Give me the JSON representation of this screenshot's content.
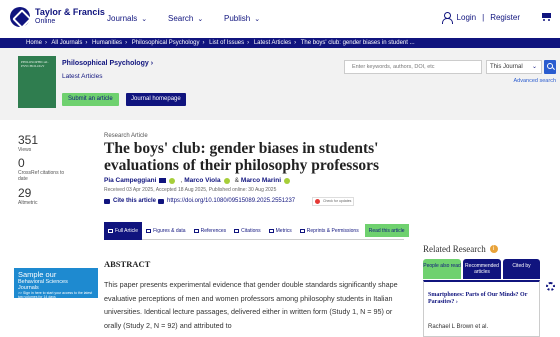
{
  "header": {
    "brand_line1": "Taylor & Francis",
    "brand_line2": "Online",
    "nav": [
      "Journals",
      "Search",
      "Publish"
    ],
    "login": "Login",
    "register": "Register"
  },
  "breadcrumb": [
    "Home",
    "All Journals",
    "Humanities",
    "Philosophical Psychology",
    "List of Issues",
    "Latest Articles",
    "The boys' club: gender biases in student ..."
  ],
  "journal": {
    "cover_text": "PHILOSOPHICAL PSYCHOLOGY",
    "title": "Philosophical Psychology",
    "issue": "Latest Articles",
    "submit_label": "Submit an article",
    "homepage_label": "Journal homepage"
  },
  "search": {
    "placeholder": "Enter keywords, authors, DOI, etc",
    "scope": "This Journal",
    "advanced": "Advanced search"
  },
  "metrics": [
    {
      "value": "351",
      "label": "Views"
    },
    {
      "value": "0",
      "label": "CrossRef citations to date"
    },
    {
      "value": "29",
      "label": "Altmetric"
    }
  ],
  "article": {
    "type": "Research Article",
    "title": "The boys' club: gender biases in students' evaluations of their philosophy professors",
    "authors": [
      "Pia Campeggiani",
      "Marco Viola",
      "Marco Marini"
    ],
    "dates": "Received 03 Apr 2025, Accepted 18 Aug 2025, Published online: 30 Aug 2025",
    "cite": "Cite this article",
    "doi": "https://doi.org/10.1080/09515089.2025.2551237",
    "crossmark": "Check for updates"
  },
  "tabs": [
    "Full Article",
    "Figures & data",
    "References",
    "Citations",
    "Metrics",
    "Reprints & Permissions",
    "Read this article"
  ],
  "sample_ad": {
    "line1": "Sample our",
    "line2": "Behavioral Sciences",
    "line3": "Journals",
    "cta": ">> Sign in here to start your access to the latest two volumes for 14 days"
  },
  "abstract": {
    "heading": "ABSTRACT",
    "text": "This paper presents experimental evidence that gender double standards significantly shape evaluative perceptions of men and women professors among philosophy students in Italian universities. Identical lecture passages, delivered either in written form (Study 1, N = 95) or orally (Study 2, N = 92) and attributed to"
  },
  "related": {
    "heading": "Related Research",
    "tabs": [
      "People also read",
      "Recommended articles",
      "Cited by"
    ],
    "item_title": "Smartphones: Parts of Our Minds? Or Parasites?",
    "item_author": "Rachael L Brown et al."
  }
}
